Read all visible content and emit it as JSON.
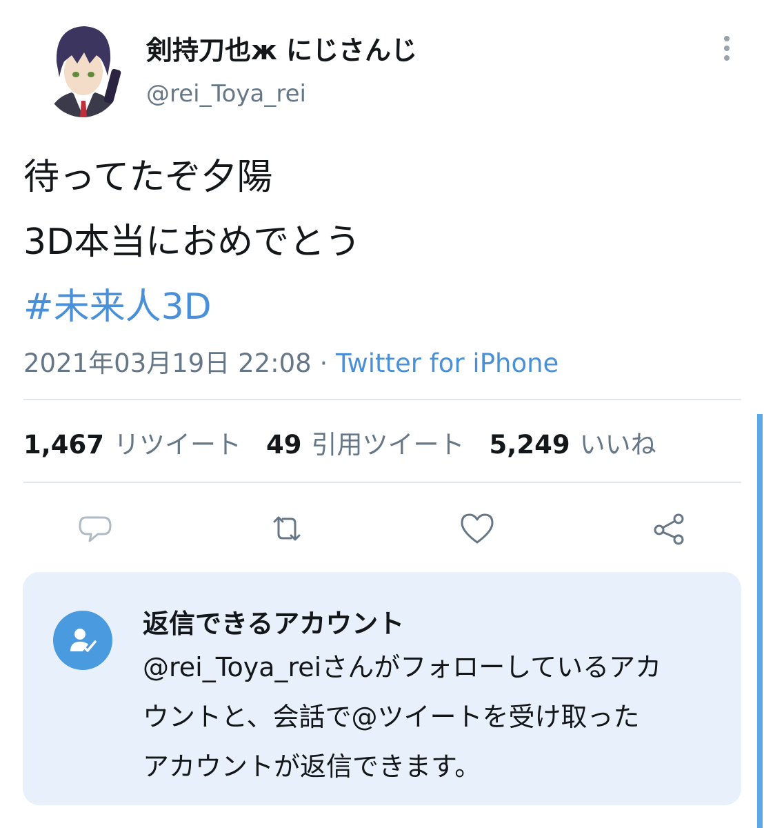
{
  "user": {
    "display_name": "剣持刀也ж にじさんじ",
    "handle": "@rei_Toya_rei"
  },
  "tweet": {
    "lines": [
      "待ってたぞ夕陽",
      "3D本当におめでとう"
    ],
    "hashtag": "#未来人3D",
    "timestamp": "2021年03月19日 22:08",
    "separator": " · ",
    "source": "Twitter for iPhone"
  },
  "stats": [
    {
      "count": "1,467",
      "label": "リツイート"
    },
    {
      "count": "49",
      "label": "引用ツイート"
    },
    {
      "count": "5,249",
      "label": "いいね"
    }
  ],
  "actions": [
    "reply-icon",
    "retweet-icon",
    "like-icon",
    "share-icon"
  ],
  "reply_restriction": {
    "title": "返信できるアカウント",
    "body_lines": [
      "@rei_Toya_reiさんがフォローしているアカ",
      "ウントと、会話で@ツイートを受け取った",
      "アカウントが返信できます。"
    ]
  },
  "colors": {
    "link": "#4a90d9",
    "secondary_text": "#657786",
    "reply_box_bg": "#e8f1fb",
    "badge": "#4a9ae0"
  }
}
